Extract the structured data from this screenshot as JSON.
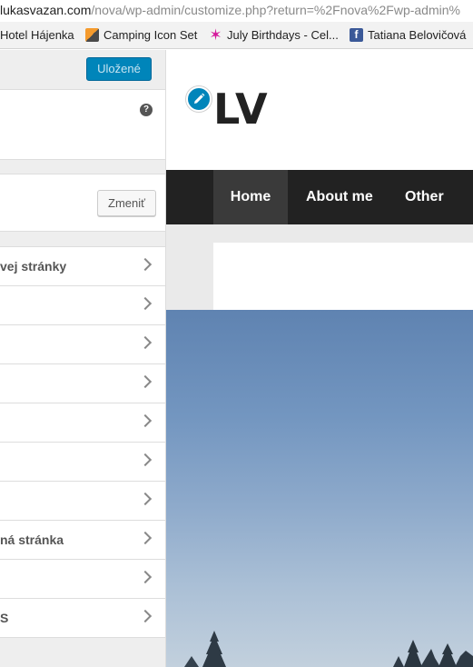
{
  "browser": {
    "url_domain": "lukasvazan.com",
    "url_path": "/nova/wp-admin/customize.php?return=%2Fnova%2Fwp-admin%",
    "bookmarks": [
      {
        "label": "Hotel Hájenka",
        "icon": "bookmark-icon"
      },
      {
        "label": "Camping Icon Set",
        "icon": "camping-icon"
      },
      {
        "label": "July Birthdays - Cel...",
        "icon": "star-icon"
      },
      {
        "label": "Tatiana Belovičová",
        "icon": "facebook-icon"
      }
    ]
  },
  "customizer": {
    "save_label": "Uložené",
    "change_label": "Zmeniť",
    "help_glyph": "?",
    "sections": [
      {
        "label": "vej stránky"
      },
      {
        "label": ""
      },
      {
        "label": ""
      },
      {
        "label": ""
      },
      {
        "label": ""
      },
      {
        "label": ""
      },
      {
        "label": ""
      },
      {
        "label": "ná stránka"
      },
      {
        "label": ""
      },
      {
        "label": "S"
      }
    ]
  },
  "preview": {
    "site_title": "LV",
    "nav": [
      {
        "label": "Home",
        "active": true
      },
      {
        "label": "About me",
        "active": false
      },
      {
        "label": "Other",
        "active": false
      }
    ]
  },
  "colors": {
    "accent": "#0085ba",
    "nav_bg": "#222222",
    "nav_active_bg": "#3a3a3a"
  }
}
